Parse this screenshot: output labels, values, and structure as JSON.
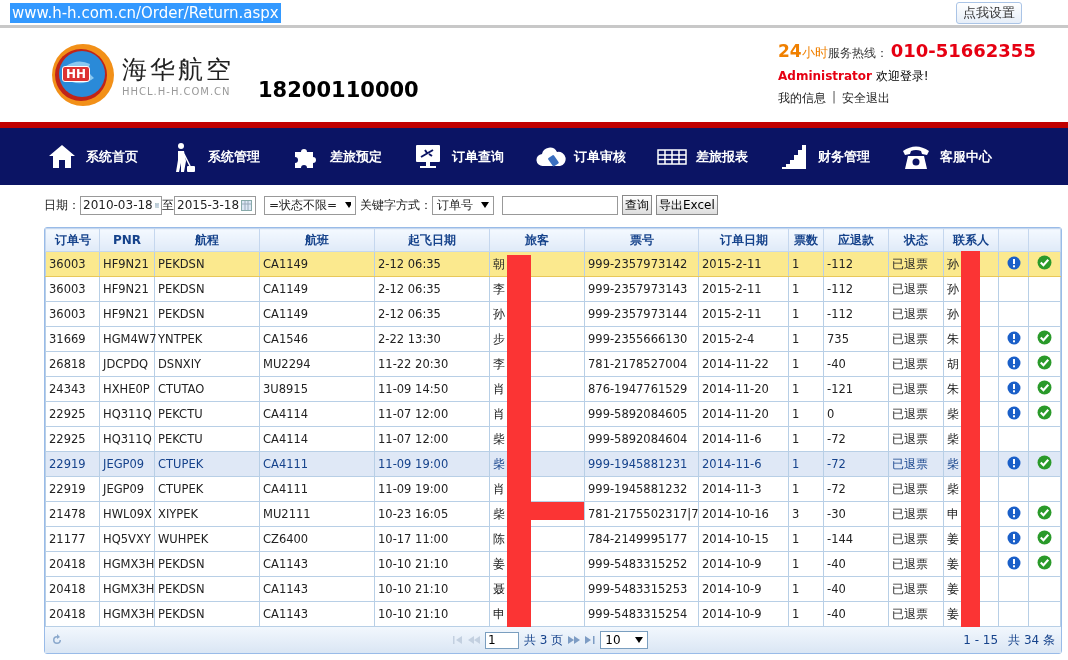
{
  "browser": {
    "url": "www.h-h.com.cn/Order/Return.aspx",
    "settings_button": "点我设置"
  },
  "header": {
    "logo_badge": "HH",
    "logo_text": "海华航空",
    "logo_subtext": "HHCL.H-H.COM.CN",
    "account": "18200110000",
    "hotline_hours_number": "24",
    "hotline_hours_unit": "小时",
    "hotline_label": "服务热线：",
    "hotline_number": "010-51662355",
    "user": "Administrator",
    "welcome": "欢迎登录!",
    "links": [
      "我的信息",
      "安全退出"
    ],
    "link_separator": "|"
  },
  "nav": [
    {
      "label": "系统首页"
    },
    {
      "label": "系统管理"
    },
    {
      "label": "差旅预定"
    },
    {
      "label": "订单查询"
    },
    {
      "label": "订单审核"
    },
    {
      "label": "差旅报表"
    },
    {
      "label": "财务管理"
    },
    {
      "label": "客服中心"
    }
  ],
  "filter": {
    "date_label": "日期：",
    "date_from": "2010-03-18",
    "to_label": "至",
    "date_to": "2015-3-18",
    "status": "=状态不限=",
    "keyword_label": "关键字方式：",
    "keyword_type": "订单号",
    "search_button": "查询",
    "export_button": "导出Excel"
  },
  "table": {
    "columns": [
      "订单号",
      "PNR",
      "航程",
      "航班",
      "起飞日期",
      "旅客",
      "票号",
      "订单日期",
      "票数",
      "应退款",
      "状态",
      "联系人"
    ],
    "rows": [
      {
        "cells": [
          "36003",
          "HF9N21",
          "PEKDSN",
          "CA1149",
          "2-12 06:35",
          "朝",
          "999-2357973142",
          "2015-2-11",
          "1",
          "-112",
          "已退票",
          "孙"
        ],
        "actions": true,
        "selected": true,
        "hovered": false
      },
      {
        "cells": [
          "36003",
          "HF9N21",
          "PEKDSN",
          "CA1149",
          "2-12 06:35",
          "李",
          "999-2357973143",
          "2015-2-11",
          "1",
          "-112",
          "已退票",
          "孙"
        ],
        "actions": false,
        "selected": false,
        "hovered": false
      },
      {
        "cells": [
          "36003",
          "HF9N21",
          "PEKDSN",
          "CA1149",
          "2-12 06:35",
          "孙",
          "999-2357973144",
          "2015-2-11",
          "1",
          "-112",
          "已退票",
          "孙"
        ],
        "actions": false,
        "selected": false,
        "hovered": false
      },
      {
        "cells": [
          "31669",
          "HGM4W7",
          "YNTPEK",
          "CA1546",
          "2-22 13:30",
          "步",
          "999-2355666130",
          "2015-2-4",
          "1",
          "735",
          "已退票",
          "朱"
        ],
        "actions": true,
        "selected": false,
        "hovered": false
      },
      {
        "cells": [
          "26818",
          "JDCPDQ",
          "DSNXIY",
          "MU2294",
          "11-22 20:30",
          "李",
          "781-2178527004",
          "2014-11-22",
          "1",
          "-40",
          "已退票",
          "胡"
        ],
        "actions": true,
        "selected": false,
        "hovered": false
      },
      {
        "cells": [
          "24343",
          "HXHE0P",
          "CTUTAO",
          "3U8915",
          "11-09 14:50",
          "肖",
          "876-1947761529",
          "2014-11-20",
          "1",
          "-121",
          "已退票",
          "朱"
        ],
        "actions": true,
        "selected": false,
        "hovered": false
      },
      {
        "cells": [
          "22925",
          "HQ311Q",
          "PEKCTU",
          "CA4114",
          "11-07 12:00",
          "肖",
          "999-5892084605",
          "2014-11-20",
          "1",
          "0",
          "已退票",
          "柴"
        ],
        "actions": true,
        "selected": false,
        "hovered": false
      },
      {
        "cells": [
          "22925",
          "HQ311Q",
          "PEKCTU",
          "CA4114",
          "11-07 12:00",
          "柴",
          "999-5892084604",
          "2014-11-6",
          "1",
          "-72",
          "已退票",
          "柴"
        ],
        "actions": false,
        "selected": false,
        "hovered": false
      },
      {
        "cells": [
          "22919",
          "JEGP09",
          "CTUPEK",
          "CA4111",
          "11-09 19:00",
          "柴",
          "999-1945881231",
          "2014-11-6",
          "1",
          "-72",
          "已退票",
          "柴"
        ],
        "actions": true,
        "selected": false,
        "hovered": true
      },
      {
        "cells": [
          "22919",
          "JEGP09",
          "CTUPEK",
          "CA4111",
          "11-09 19:00",
          "肖",
          "999-1945881232",
          "2014-11-3",
          "1",
          "-72",
          "已退票",
          "柴"
        ],
        "actions": false,
        "selected": false,
        "hovered": false
      },
      {
        "cells": [
          "21478",
          "HWL09X",
          "XIYPEK",
          "MU2111",
          "10-23 16:05",
          "柴",
          "781-2175502317|7",
          "2014-10-16",
          "3",
          "-30",
          "已退票",
          "申"
        ],
        "actions": true,
        "selected": false,
        "hovered": false
      },
      {
        "cells": [
          "21177",
          "HQ5VXY",
          "WUHPEK",
          "CZ6400",
          "10-17 11:00",
          "陈",
          "784-2149995177",
          "2014-10-15",
          "1",
          "-144",
          "已退票",
          "姜"
        ],
        "actions": true,
        "selected": false,
        "hovered": false
      },
      {
        "cells": [
          "20418",
          "HGMX3H",
          "PEKDSN",
          "CA1143",
          "10-10 21:10",
          "姜",
          "999-5483315252",
          "2014-10-9",
          "1",
          "-40",
          "已退票",
          "姜"
        ],
        "actions": true,
        "selected": false,
        "hovered": false
      },
      {
        "cells": [
          "20418",
          "HGMX3H",
          "PEKDSN",
          "CA1143",
          "10-10 21:10",
          "聂",
          "999-5483315253",
          "2014-10-9",
          "1",
          "-40",
          "已退票",
          "姜"
        ],
        "actions": false,
        "selected": false,
        "hovered": false
      },
      {
        "cells": [
          "20418",
          "HGMX3H",
          "PEKDSN",
          "CA1143",
          "10-10 21:10",
          "申",
          "999-5483315254",
          "2014-10-9",
          "1",
          "-40",
          "已退票",
          "姜"
        ],
        "actions": false,
        "selected": false,
        "hovered": false
      }
    ]
  },
  "pager": {
    "page": "1",
    "pages_text": "共 3 页",
    "page_size": "10",
    "range": "1 - 15",
    "total": "共 34 条"
  }
}
